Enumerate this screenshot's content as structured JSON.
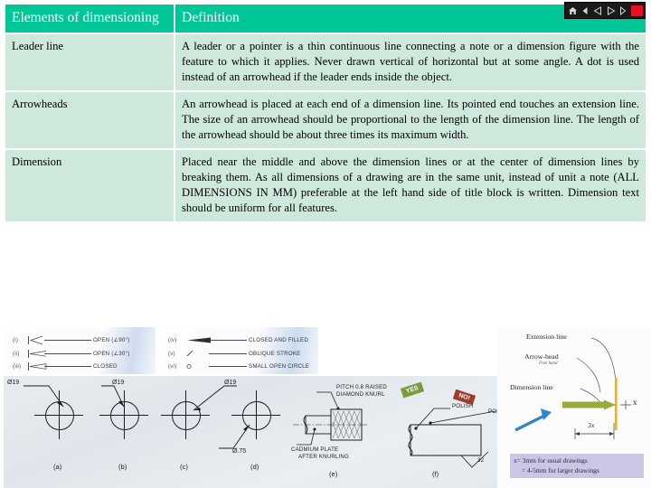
{
  "nav": {
    "home_label": "Home",
    "prev_label": "Previous slide",
    "play_label": "Play",
    "next_label": "Next slide",
    "stop_label": "Stop",
    "bar_bg": "#1a1a1a",
    "stop_color": "#e81123"
  },
  "table": {
    "accent": "#00c795",
    "cell_bg": "#cfe8dc",
    "headers": {
      "term": "Elements of dimensioning",
      "definition": "Definition"
    },
    "rows": [
      {
        "term": "Leader line",
        "definition": "A leader or a pointer is a thin continuous line connecting a note or a dimension figure with the feature to which it applies. Never drawn vertical of horizontal but at some angle. A dot is used instead of an arrowhead if the leader ends inside the object."
      },
      {
        "term": "Arrowheads",
        "definition": "An arrowhead is placed at each end of a dimension line. Its pointed end touches an extension line. The size of an arrowhead should be proportional to the length of the dimension line. The length of the arrowhead should be about three times its maximum width."
      },
      {
        "term": "Dimension",
        "definition": "Placed near the middle and above the dimension lines or at the center of dimension lines by breaking them. As all dimensions of a drawing are in the same unit, instead of unit a note (ALL DIMENSIONS IN MM) preferable at the left hand side of title block is written. Dimension text should be uniform for all features."
      }
    ]
  },
  "figures": {
    "arrowhead_legend_left": [
      {
        "num": "(i)",
        "label": "OPEN (∠90°)"
      },
      {
        "num": "(ii)",
        "label": "OPEN (∠30°)"
      },
      {
        "num": "(iii)",
        "label": "CLOSED"
      }
    ],
    "arrowhead_legend_right": [
      {
        "num": "(iv)",
        "label": "CLOSED AND FILLED"
      },
      {
        "num": "(v)",
        "label": "OBLIQUE STROKE"
      },
      {
        "num": "(vi)",
        "label": "SMALL OPEN CIRCLE"
      }
    ],
    "extension_panel": {
      "extension_line": "Extension line",
      "arrow_head": "Arrow-head",
      "arrow_head_sub": "Free hand",
      "dimension_line": "Dimension line",
      "x_mark": "x",
      "three_x": "3x",
      "note_line1": "x= 3mm for usual drawings",
      "note_line2": "= 4-5mm for larger drawings"
    },
    "leader_examples": {
      "diameter_label": "Ø19",
      "small_diameter_label": "Ø.75",
      "captions": [
        "(a)",
        "(b)",
        "(c)",
        "(d)",
        "(e)",
        "(f)"
      ],
      "knurl_note_line1": "PITCH 0.8 RAISED",
      "knurl_note_line2": "DIAMOND KNURL",
      "cadmium_note_line1": "CADMIUM PLATE",
      "cadmium_note_line2": "AFTER KNURLING",
      "polish_label": "POLISH",
      "pol_label": "POL",
      "yes_badge": "YES",
      "no_badge": "NO!",
      "finish_value": "32"
    }
  }
}
